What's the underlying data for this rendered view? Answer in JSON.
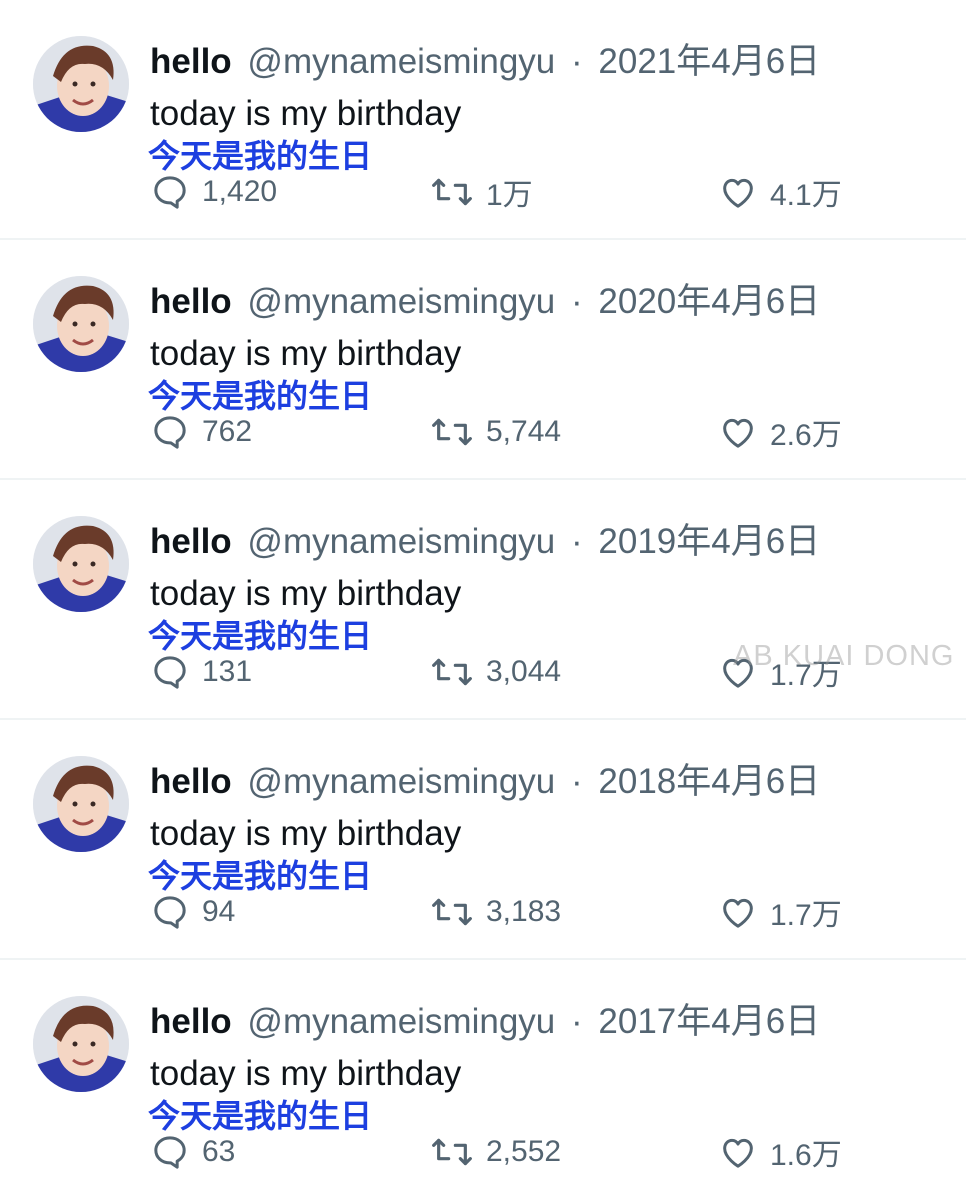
{
  "tweets": [
    {
      "display_name": "hello",
      "handle": "@mynameismingyu",
      "separator": "·",
      "date": "2021年4月6日",
      "text": "today is my birthday",
      "translation": "今天是我的生日",
      "replies": "1,420",
      "retweets": "1万",
      "likes": "4.1万"
    },
    {
      "display_name": "hello",
      "handle": "@mynameismingyu",
      "separator": "·",
      "date": "2020年4月6日",
      "text": "today is my birthday",
      "translation": "今天是我的生日",
      "replies": "762",
      "retweets": "5,744",
      "likes": "2.6万"
    },
    {
      "display_name": "hello",
      "handle": "@mynameismingyu",
      "separator": "·",
      "date": "2019年4月6日",
      "text": "today is my birthday",
      "translation": "今天是我的生日",
      "replies": "131",
      "retweets": "3,044",
      "likes": "1.7万"
    },
    {
      "display_name": "hello",
      "handle": "@mynameismingyu",
      "separator": "·",
      "date": "2018年4月6日",
      "text": "today is my birthday",
      "translation": "今天是我的生日",
      "replies": "94",
      "retweets": "3,183",
      "likes": "1.7万"
    },
    {
      "display_name": "hello",
      "handle": "@mynameismingyu",
      "separator": "·",
      "date": "2017年4月6日",
      "text": "today is my birthday",
      "translation": "今天是我的生日",
      "replies": "63",
      "retweets": "2,552",
      "likes": "1.6万"
    }
  ],
  "watermark": "AB KUAI DONG",
  "icons": {
    "reply": "reply-icon",
    "retweet": "retweet-icon",
    "like": "like-icon"
  },
  "colors": {
    "text": "#0f1419",
    "secondary": "#536471",
    "translation": "#1d3fe0",
    "divider": "#eff3f4"
  }
}
